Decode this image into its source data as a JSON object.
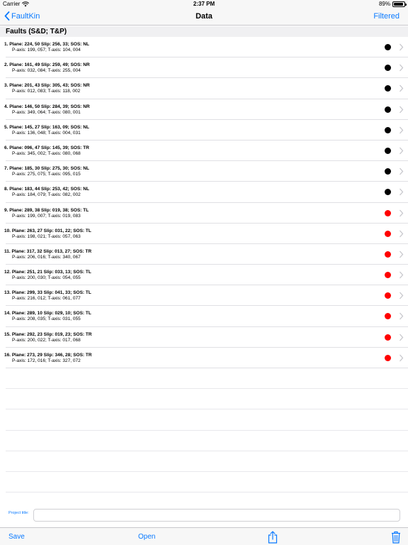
{
  "status_bar": {
    "carrier": "Carrier",
    "time": "2:37 PM",
    "battery": "89%",
    "battery_level": 0.89
  },
  "nav": {
    "back_label": "FaultKin",
    "title": "Data",
    "right_label": "Filtered"
  },
  "section": {
    "title": "Faults (S&D; T&P)"
  },
  "colors": {
    "accent": "#0a7aff",
    "dot_black": "#000000",
    "dot_red": "#ff0000"
  },
  "faults": [
    {
      "line1": "1.  Plane: 224,  50  Slip: 256,  33;  SOS: NL",
      "line2": "P-axis: 199, 057;  T-axis: 104, 004",
      "dot": "black"
    },
    {
      "line1": "2.  Plane: 161,  49  Slip: 259,  49;  SOS: NR",
      "line2": "P-axis: 032, 084;  T-axis: 255, 004",
      "dot": "black"
    },
    {
      "line1": "3.  Plane: 201,  43  Slip: 305,  43;  SOS: NR",
      "line2": "P-axis: 012, 083;  T-axis: 118, 002",
      "dot": "black"
    },
    {
      "line1": "4.  Plane: 146,  50  Slip: 284,  39;  SOS: NR",
      "line2": "P-axis: 349, 064;  T-axis: 080, 001",
      "dot": "black"
    },
    {
      "line1": "5.  Plane: 145,  27  Slip: 163,  09;  SOS: NL",
      "line2": "P-axis: 136, 048;  T-axis: 004, 031",
      "dot": "black"
    },
    {
      "line1": "6.  Plane: 096,  47  Slip: 145,  39;  SOS: TR",
      "line2": "P-axis: 345, 002;  T-axis: 080, 068",
      "dot": "black"
    },
    {
      "line1": "7.  Plane: 185,  30  Slip: 275,  30;  SOS: NL",
      "line2": "P-axis: 275, 075;  T-axis: 095, 015",
      "dot": "black"
    },
    {
      "line1": "8.  Plane: 183,  44  Slip: 253,  42;  SOS: NL",
      "line2": "P-axis: 184, 079;  T-axis: 082, 002",
      "dot": "black"
    },
    {
      "line1": "9.  Plane: 289,  38  Slip: 019,  38;  SOS: TL",
      "line2": "P-axis: 199, 007;  T-axis: 019, 083",
      "dot": "red"
    },
    {
      "line1": "10.  Plane: 263,  27  Slip: 031,  22;  SOS: TL",
      "line2": "P-axis: 198, 021;  T-axis: 057, 063",
      "dot": "red"
    },
    {
      "line1": "11.  Plane: 317,  32  Slip: 013,  27;  SOS: TR",
      "line2": "P-axis: 206, 016;  T-axis: 340, 067",
      "dot": "red"
    },
    {
      "line1": "12.  Plane: 251,  21  Slip: 033,  13;  SOS: TL",
      "line2": "P-axis: 200, 030;  T-axis: 054, 055",
      "dot": "red"
    },
    {
      "line1": "13.  Plane: 299,  33  Slip: 041,  33;  SOS: TL",
      "line2": "P-axis: 216, 012;  T-axis: 061, 077",
      "dot": "red"
    },
    {
      "line1": "14.  Plane: 289,  10  Slip: 029,  10;  SOS: TL",
      "line2": "P-axis: 208, 035;  T-axis: 031, 055",
      "dot": "red"
    },
    {
      "line1": "15.  Plane: 292,  23  Slip: 019,  23;  SOS: TR",
      "line2": "P-axis: 200, 022;  T-axis: 017, 068",
      "dot": "red"
    },
    {
      "line1": "16.  Plane: 273,  29  Slip: 346,  28;  SOS: TR",
      "line2": "P-axis: 172, 016;  T-axis: 327, 072",
      "dot": "red"
    }
  ],
  "project": {
    "label": "Project title:",
    "value": ""
  },
  "toolbar": {
    "save_label": "Save",
    "open_label": "Open",
    "share_icon": "share-icon",
    "trash_icon": "trash-icon"
  }
}
